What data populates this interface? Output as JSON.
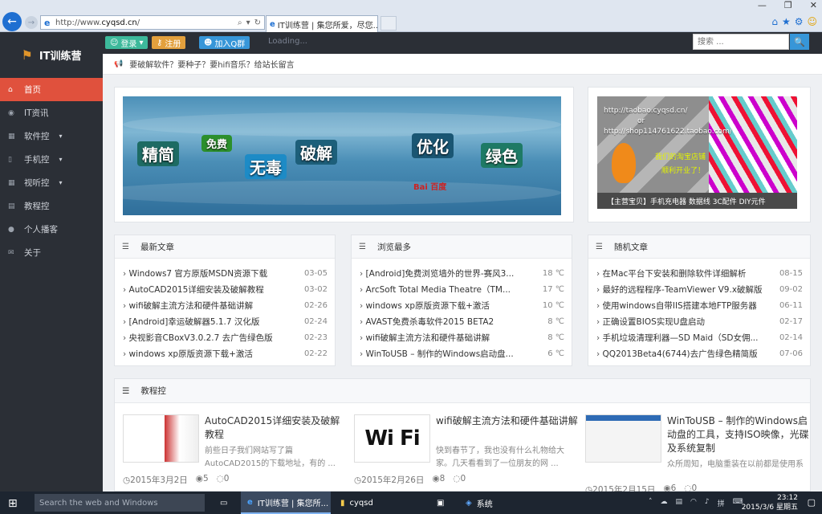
{
  "browser": {
    "url_prefix": "http://www.",
    "url_domain": "cyqsd.cn",
    "url_suffix": "/",
    "tab_title": "IT训练营 | 集您所爱，尽您...",
    "ie_glyph": "e"
  },
  "site": {
    "logo": "IT训练营",
    "login": "登录",
    "register": "注册",
    "qq": "加入Q群",
    "loading": "Loading...",
    "search_placeholder": "搜索 ..."
  },
  "nav": [
    {
      "label": "首页",
      "icon": "home-icon",
      "glyph": "⌂"
    },
    {
      "label": "IT资讯",
      "icon": "eye-icon",
      "glyph": "◉"
    },
    {
      "label": "软件控",
      "icon": "grid-icon",
      "glyph": "▦",
      "caret": "▾"
    },
    {
      "label": "手机控",
      "icon": "phone-icon",
      "glyph": "▯",
      "caret": "▾"
    },
    {
      "label": "视听控",
      "icon": "grid-icon",
      "glyph": "▦",
      "caret": "▾"
    },
    {
      "label": "教程控",
      "icon": "doc-icon",
      "glyph": "▤"
    },
    {
      "label": "个人播客",
      "icon": "user-icon",
      "glyph": "●"
    },
    {
      "label": "关于",
      "icon": "mail-icon",
      "glyph": "✉"
    }
  ],
  "notice": "要破解软件？要种子？要hifi音乐？给站长留言",
  "banner1": {
    "words": [
      "精简",
      "免费",
      "无毒",
      "破解",
      "优化",
      "绿色"
    ],
    "brand": "Bai 百度"
  },
  "banner2": {
    "url1": "http://taobao.cyqsd.cn/",
    "or": "or",
    "url2": "http://shop114761622.taobao.com/",
    "shop1": "我们的淘宝店铺",
    "shop2": "顺利开业了！",
    "bottom": "【主营宝贝】手机充电器 数据线 3C配件 DIY元件"
  },
  "lists": [
    {
      "title": "最新文章",
      "items": [
        {
          "t": "Windows7 官方原版MSDN资源下载",
          "d": "03-05"
        },
        {
          "t": "AutoCAD2015详细安装及破解教程",
          "d": "03-02"
        },
        {
          "t": "wifi破解主流方法和硬件基础讲解",
          "d": "02-26"
        },
        {
          "t": "[Android]幸运破解器5.1.7 汉化版",
          "d": "02-24"
        },
        {
          "t": "央视影音CBoxV3.0.2.7 去广告绿色版",
          "d": "02-23"
        },
        {
          "t": "windows xp原版资源下载+激活",
          "d": "02-22"
        }
      ]
    },
    {
      "title": "浏览最多",
      "items": [
        {
          "t": "[Android]免费浏览墙外的世界-赛风3...",
          "d": "18 ℃"
        },
        {
          "t": "ArcSoft Total Media Theatre（TM...",
          "d": "17 ℃"
        },
        {
          "t": "windows xp原版资源下载+激活",
          "d": "10 ℃"
        },
        {
          "t": "AVAST免费杀毒软件2015 BETA2",
          "d": "8 ℃"
        },
        {
          "t": "wifi破解主流方法和硬件基础讲解",
          "d": "8 ℃"
        },
        {
          "t": "WinToUSB – 制作的Windows启动盘...",
          "d": "6 ℃"
        }
      ]
    },
    {
      "title": "随机文章",
      "items": [
        {
          "t": "在Mac平台下安装和删除软件详细解析",
          "d": "08-15"
        },
        {
          "t": "最好的远程程序-TeamViewer V9.x破解版",
          "d": "09-02"
        },
        {
          "t": "使用windows自带IIS搭建本地FTP服务器",
          "d": "06-11"
        },
        {
          "t": "正确设置BIOS实现U盘启动",
          "d": "02-17"
        },
        {
          "t": "手机垃圾清理利器—SD Maid（SD女佣...",
          "d": "02-14"
        },
        {
          "t": "QQ2013Beta4(6744)去广告绿色精简版",
          "d": "07-06"
        }
      ]
    }
  ],
  "tutorials": {
    "title": "教程控",
    "posts": [
      {
        "title": "AutoCAD2015详细安装及破解教程",
        "desc": "前些日子我们网站写了篇AutoCAD2015的下载地址，有的 ...",
        "date": "2015年3月2日",
        "views": "5",
        "comments": "0"
      },
      {
        "title": "wifi破解主流方法和硬件基础讲解",
        "desc": "快到春节了，我也没有什么礼物给大家。几天看看到了一位朋友的网 ...",
        "date": "2015年2月26日",
        "views": "8",
        "comments": "0",
        "thumb_text": "Wi Fi"
      },
      {
        "title": "WinToUSB – 制作的Windows启动盘的工具，支持ISO映像，光碟及系统复制",
        "desc": "众所周知，电脑重装在以前都是使用系统安装光碟的比较多，后来随 ...",
        "date": "2015年2月15日",
        "views": "6",
        "comments": "0"
      }
    ]
  },
  "taskbar": {
    "search": "Search the web and Windows",
    "tasks": [
      {
        "label": "IT训练营 | 集您所...",
        "icon": "ie-icon"
      },
      {
        "label": "cyqsd",
        "icon": "folder-icon"
      },
      {
        "label": "",
        "icon": "store-icon"
      },
      {
        "label": "系统",
        "icon": "system-icon"
      }
    ],
    "time": "23:12",
    "date": "2015/3/6 星期五"
  },
  "icons": {
    "date": "◷",
    "views": "◉",
    "comments": "◌",
    "list": "☰",
    "notice": "📢",
    "search": "🔍"
  },
  "colors": {
    "accent": "#e0513d",
    "sidebar": "#2b2f36",
    "login": "#3db99b",
    "register": "#e3a03d",
    "qq": "#3796d8"
  }
}
